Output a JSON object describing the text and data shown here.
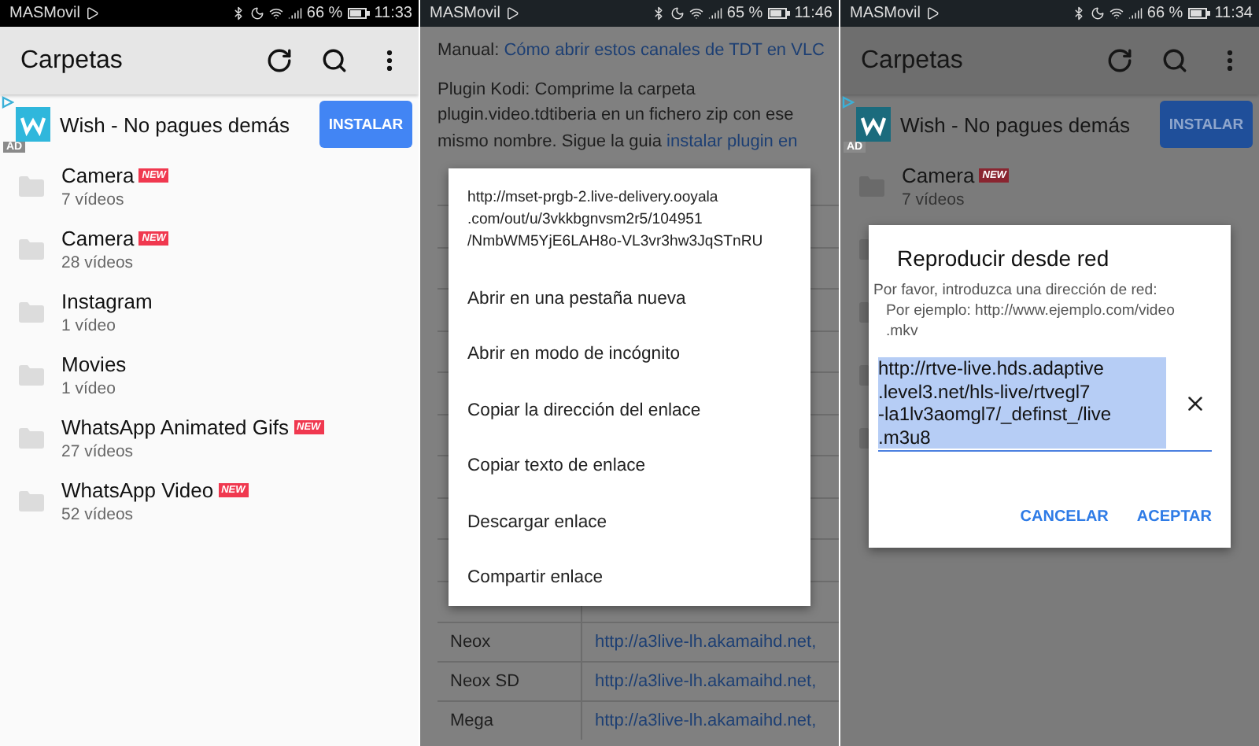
{
  "screens": [
    {
      "kind": "folders",
      "dimmed": false,
      "status_bar": {
        "carrier": "MASMovil",
        "battery": "66 %",
        "time": "11:33"
      },
      "app_bar": {
        "title": "Carpetas"
      },
      "ad": {
        "title": "Wish - No pagues demás",
        "button": "INSTALAR",
        "tag": "AD"
      },
      "folders": [
        {
          "name": "Camera",
          "count": "7 vídeos",
          "badge": "NEW"
        },
        {
          "name": "Camera",
          "count": "28 vídeos",
          "badge": "NEW"
        },
        {
          "name": "Instagram",
          "count": "1 vídeo"
        },
        {
          "name": "Movies",
          "count": "1 vídeo"
        },
        {
          "name": "WhatsApp Animated Gifs",
          "count": "27 vídeos",
          "badge": "NEW"
        },
        {
          "name": "WhatsApp Video",
          "count": "52 vídeos",
          "badge": "NEW"
        }
      ]
    },
    {
      "kind": "browser",
      "dimmed": true,
      "status_bar": {
        "carrier": "MASMovil",
        "battery": "65 %",
        "time": "11:46"
      },
      "page": {
        "manual_label": "Manual:",
        "manual_link": "Cómo abrir estos canales de TDT en VLC",
        "paragraph": "Plugin Kodi: Comprime la carpeta plugin.video.tdtiberia en un fichero zip con ese mismo nombre. Sigue la guia",
        "paragraph_link": "instalar plugin en",
        "rows": [
          {
            "channel": "Neox",
            "url": "http://a3live-lh.akamaihd.net,"
          },
          {
            "channel": "Neox SD",
            "url": "http://a3live-lh.akamaihd.net,"
          },
          {
            "channel": "Mega",
            "url": "http://a3live-lh.akamaihd.net,"
          }
        ]
      },
      "context_menu": {
        "url": "http://mset-prgb-2.live-delivery.ooyala\n.com/out/u/3vkkbgnvsm2r5/104951\n/NmbWM5YjE6LAH8o-VL3vr3hw3JqSTnRU",
        "items": [
          "Abrir en una pestaña nueva",
          "Abrir en modo de incógnito",
          "Copiar la dirección del enlace",
          "Copiar texto de enlace",
          "Descargar enlace",
          "Compartir enlace"
        ]
      }
    },
    {
      "kind": "folders",
      "dimmed": true,
      "status_bar": {
        "carrier": "MASMovil",
        "battery": "66 %",
        "time": "11:34"
      },
      "app_bar": {
        "title": "Carpetas"
      },
      "ad": {
        "title": "Wish - No pagues demás",
        "button": "INSTALAR",
        "tag": "AD"
      },
      "folders": [
        {
          "name": "Camera",
          "count": "7 vídeos",
          "badge": "NEW"
        }
      ],
      "dialog": {
        "title": "Reproducir desde red",
        "hint": "Por favor, introduzca una dirección de red:",
        "example": "Por ejemplo: http://www.ejemplo.com/video\n.mkv",
        "value": "http://rtve-live.hds.adaptive\n.level3.net/hls-live/rtvegl7\n-la1lv3aomgl7/_definst_/live\n.m3u8",
        "value_selected": true,
        "buttons": [
          "CANCELAR",
          "ACEPTAR"
        ]
      }
    }
  ]
}
